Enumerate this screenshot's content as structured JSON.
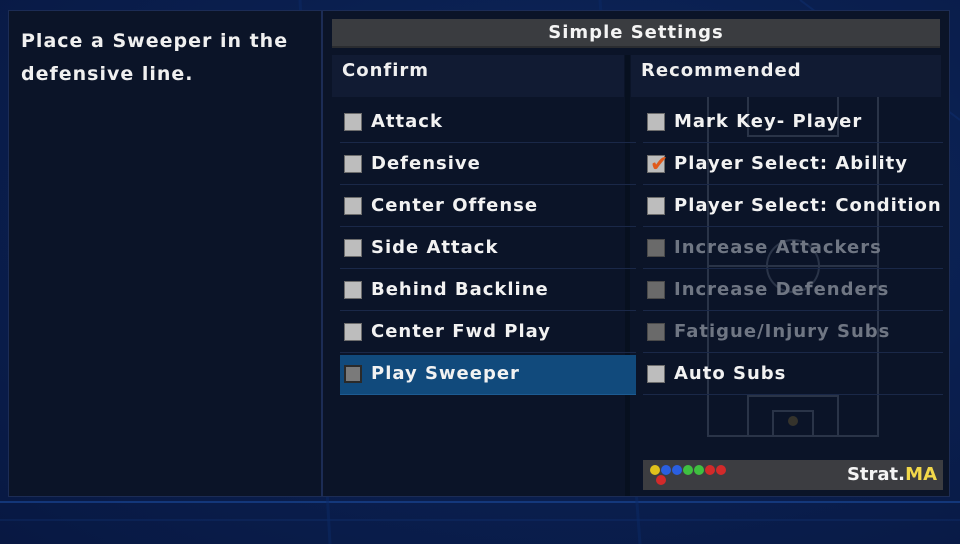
{
  "description": "Place a Sweeper in the defensive line.",
  "settings": {
    "title": "Simple Settings",
    "confirm_header": "Confirm",
    "recommended_header": "Recommended",
    "confirm_items": [
      {
        "label": "Attack",
        "checked": false,
        "disabled": false
      },
      {
        "label": "Defensive",
        "checked": false,
        "disabled": false
      },
      {
        "label": "Center Offense",
        "checked": false,
        "disabled": false
      },
      {
        "label": "Side Attack",
        "checked": false,
        "disabled": false
      },
      {
        "label": "Behind Backline",
        "checked": false,
        "disabled": false
      },
      {
        "label": "Center Fwd Play",
        "checked": false,
        "disabled": false
      },
      {
        "label": "Play Sweeper",
        "checked": false,
        "disabled": false,
        "selected": true
      }
    ],
    "recommended_items": [
      {
        "label": "Mark Key- Player",
        "checked": false,
        "disabled": false
      },
      {
        "label": "Player Select: Ability",
        "checked": true,
        "disabled": false
      },
      {
        "label": "Player Select: Condition",
        "checked": false,
        "disabled": false
      },
      {
        "label": "Increase Attackers",
        "checked": false,
        "disabled": true
      },
      {
        "label": "Increase Defenders",
        "checked": false,
        "disabled": true
      },
      {
        "label": "Fatigue/Injury Subs",
        "checked": false,
        "disabled": true
      },
      {
        "label": "Auto Subs",
        "checked": false,
        "disabled": false
      }
    ]
  },
  "footer": {
    "strat_label": "Strat.",
    "strat_value": "MA"
  },
  "colors": {
    "selection": "#114a7c",
    "check": "#e05a1c",
    "strat_value": "#f2d84a",
    "disabled_text": "#6f7683",
    "dots": [
      "#e0c21c",
      "#2a5fe0",
      "#2a5fe0",
      "#3fc040",
      "#3fc040",
      "#d22a2a",
      "#d22a2a"
    ]
  }
}
